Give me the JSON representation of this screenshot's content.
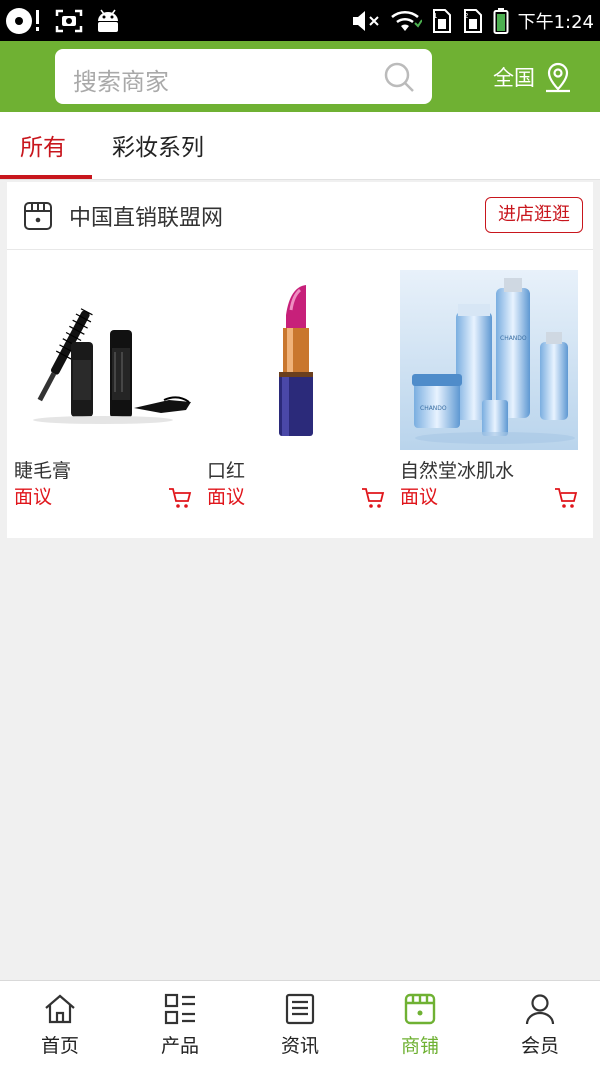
{
  "status_bar": {
    "time": "下午1:24",
    "icons": [
      "disc-icon",
      "screenshot-icon",
      "android-icon",
      "mute-icon",
      "wifi-icon",
      "sim1-icon",
      "sim2-icon",
      "battery-icon"
    ]
  },
  "header": {
    "search_placeholder": "搜索商家",
    "region_label": "全国",
    "accent_color": "#6fb133"
  },
  "tabs": [
    {
      "label": "所有",
      "active": true
    },
    {
      "label": "彩妆系列",
      "active": false
    }
  ],
  "store": {
    "name": "中国直销联盟网",
    "visit_label": "进店逛逛",
    "products": [
      {
        "name": "睫毛膏",
        "price": "面议",
        "image": "mascara-image"
      },
      {
        "name": "口红",
        "price": "面议",
        "image": "lipstick-image"
      },
      {
        "name": "自然堂冰肌水",
        "price": "面议",
        "image": "skincare-bottles-image",
        "brand_text": "CHANDO"
      }
    ]
  },
  "bottom_nav": [
    {
      "label": "首页",
      "icon": "home-icon",
      "active": false
    },
    {
      "label": "产品",
      "icon": "product-list-icon",
      "active": false
    },
    {
      "label": "资讯",
      "icon": "news-icon",
      "active": false
    },
    {
      "label": "商铺",
      "icon": "shop-icon",
      "active": true
    },
    {
      "label": "会员",
      "icon": "member-icon",
      "active": false
    }
  ],
  "colors": {
    "accent_red": "#c8161d",
    "price_red": "#e0151b",
    "active_green": "#6fb133"
  }
}
